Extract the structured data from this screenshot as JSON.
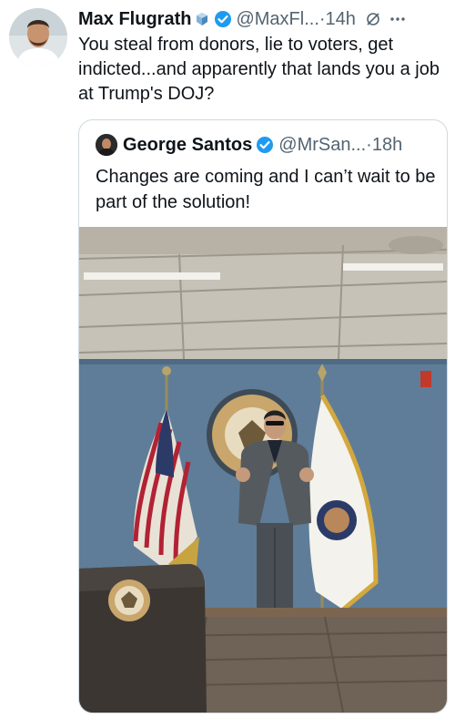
{
  "tweet": {
    "author_name": "Max Flugrath",
    "handle": "@MaxFl...",
    "separator": "·",
    "time": "14h",
    "more_icon": "more-icon",
    "text": "You steal from donors, lie to voters, get indicted...and apparently that lands you a job at Trump's DOJ?"
  },
  "quote": {
    "author_name": "George Santos",
    "handle": "@MrSan...",
    "separator": "·",
    "time": "18h",
    "text": "Changes are coming and I can’t wait to be part of the solution!"
  },
  "colors": {
    "verified": "#1d9bf0",
    "text": "#0f1419",
    "muted": "#536471",
    "border": "#cfd9de"
  }
}
